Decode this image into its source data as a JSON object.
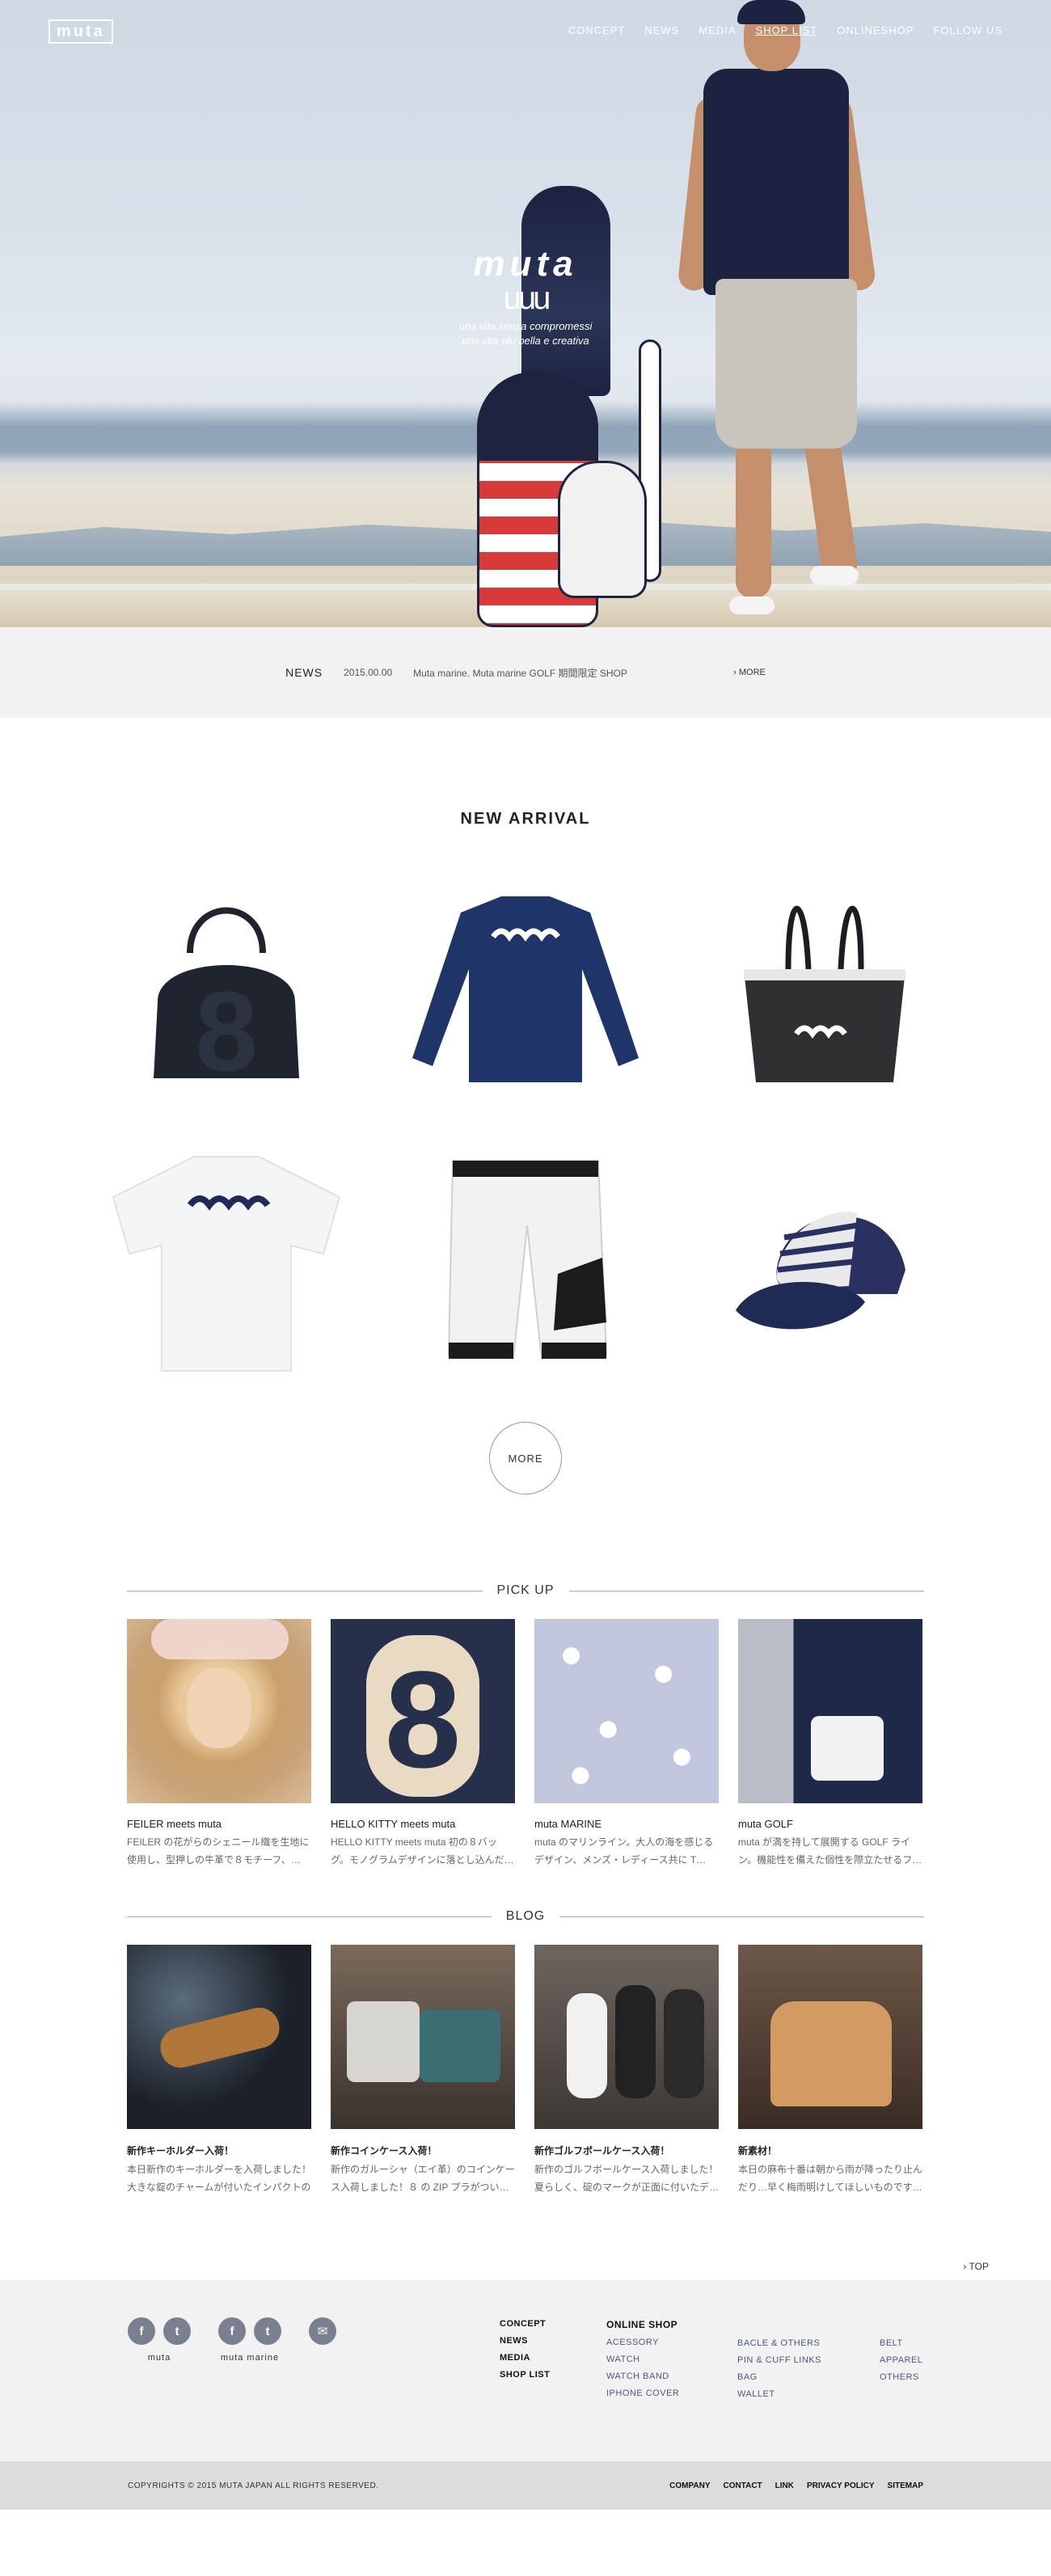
{
  "header": {
    "logo": "muta",
    "nav": [
      "CONCEPT",
      "NEWS",
      "MEDIA",
      "SHOP LIST",
      "ONLINESHOP",
      "FOLLOW US"
    ],
    "active_nav": "SHOP LIST"
  },
  "hero": {
    "brand_word": "muta",
    "brand_waves": "uuu",
    "tagline_1": "una vita senza compromessi",
    "tagline_2": "una vita piu bella e creativa"
  },
  "news": {
    "label": "NEWS",
    "date": "2015.00.00",
    "text": "Muta marine. Muta marine GOLF 期間限定 SHOP",
    "more": "› MORE"
  },
  "new_arrival": {
    "title": "NEW ARRIVAL",
    "products": [
      {
        "name": "bowling-bag-8",
        "color": "#1f242f"
      },
      {
        "name": "longsleeve-shirt",
        "color": "#1f3468"
      },
      {
        "name": "tote-bag",
        "color": "#2e3033"
      },
      {
        "name": "tshirt-marine",
        "color": "#f4f5f7"
      },
      {
        "name": "jogger-pants",
        "color": "#f2f2f2"
      },
      {
        "name": "anchor-cap",
        "color": "#1f2a55"
      }
    ],
    "more": "MORE"
  },
  "pickup": {
    "title": "PICK UP",
    "items": [
      {
        "title": "FEILER meets muta",
        "desc": "FEILER の花がらのシェニール織を生地に使用し、型押しの牛革で８モチーフ、…"
      },
      {
        "title": "HELLO KITTY meets muta",
        "desc": "HELLO KITTY meets muta 初の８バッグ。モノグラムデザインに落とし込んだ…"
      },
      {
        "title": "muta MARINE",
        "desc": "muta のマリンライン。大人の海を感じるデザイン、メンズ・レディース共に T…"
      },
      {
        "title": "muta GOLF",
        "desc": "muta が満を持して展開する GOLF ライン。機能性を備えた個性を際立たせるフ…"
      }
    ]
  },
  "blog": {
    "title": "BLOG",
    "items": [
      {
        "title": "新作キーホルダー入荷！",
        "desc": "本日新作のキーホルダーを入荷しました！大きな錠のチャームが付いたインパクトの"
      },
      {
        "title": "新作コインケース入荷！",
        "desc": "新作のガルーシャ（エイ革）のコインケース入荷しました！８ の ZIP プラがつい…"
      },
      {
        "title": "新作ゴルフボールケース入荷！",
        "desc": "新作のゴルフボールケース入荷しました！夏らしく、碇のマークが正面に付いたデ…"
      },
      {
        "title": "新素材！",
        "desc": "本日の麻布十番は朝から雨が降ったり止んだり…早く梅雨明けしてほしいものです…"
      }
    ]
  },
  "to_top": "› TOP",
  "footer": {
    "social_groups": [
      {
        "caption": "muta",
        "icons": [
          "f",
          "t"
        ]
      },
      {
        "caption": "muta marine",
        "icons": [
          "f",
          "t"
        ]
      },
      {
        "caption": "",
        "icons": [
          "✉"
        ]
      }
    ],
    "col1": [
      "CONCEPT",
      "NEWS",
      "MEDIA",
      "SHOP LIST"
    ],
    "col2_head": "ONLINE SHOP",
    "col2": [
      "ACESSORY",
      "WATCH",
      "WATCH BAND",
      "IPHONE COVER"
    ],
    "col3": [
      "BACLE & OTHERS",
      "PIN & CUFF LINKS",
      "BAG",
      "WALLET"
    ],
    "col4": [
      "BELT",
      "APPAREL",
      "OTHERS"
    ],
    "copyright": "COPYRIGHTS © 2015 MUTA JAPAN ALL RIGHTS RESERVED.",
    "bottom_links": [
      "COMPANY",
      "CONTACT",
      "LINK",
      "PRIVACY POLICY",
      "SITEMAP"
    ]
  }
}
